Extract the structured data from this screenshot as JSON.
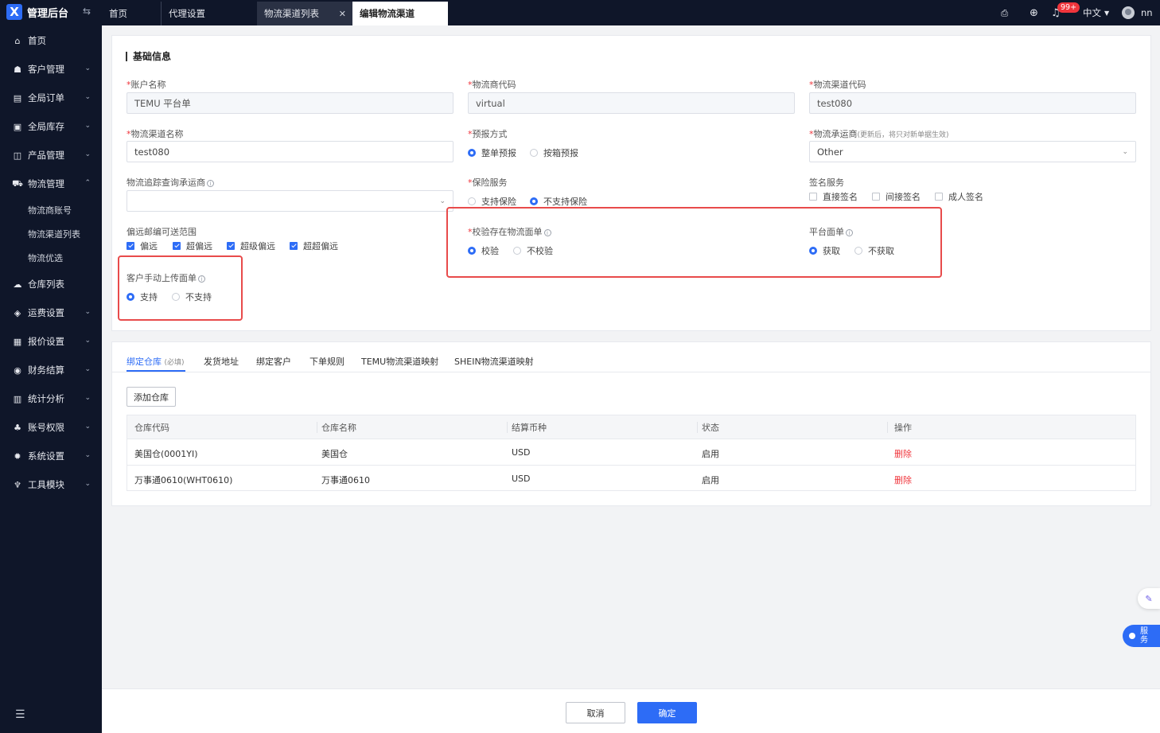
{
  "app": {
    "title": "管理后台"
  },
  "sidebar": {
    "items": [
      {
        "label": "首页",
        "icon": "home-icon",
        "glyph": "⌂"
      },
      {
        "label": "客户管理",
        "icon": "users-icon",
        "glyph": "☗"
      },
      {
        "label": "全局订单",
        "icon": "orders-icon",
        "glyph": "▤"
      },
      {
        "label": "全局库存",
        "icon": "inventory-icon",
        "glyph": "▣"
      },
      {
        "label": "产品管理",
        "icon": "products-icon",
        "glyph": "◫"
      },
      {
        "label": "物流管理",
        "icon": "truck-icon",
        "glyph": "⛟"
      }
    ],
    "logistics_sub": [
      "物流商账号",
      "物流渠道列表",
      "物流优选"
    ],
    "items_after": [
      {
        "label": "仓库列表",
        "icon": "cloud-icon",
        "glyph": "☁"
      },
      {
        "label": "运费设置",
        "icon": "freight-icon",
        "glyph": "◈"
      },
      {
        "label": "报价设置",
        "icon": "quote-icon",
        "glyph": "▦"
      },
      {
        "label": "财务结算",
        "icon": "finance-icon",
        "glyph": "◉"
      },
      {
        "label": "统计分析",
        "icon": "stats-icon",
        "glyph": "▥"
      },
      {
        "label": "账号权限",
        "icon": "permissions-icon",
        "glyph": "♣"
      },
      {
        "label": "系统设置",
        "icon": "settings-icon",
        "glyph": "✹"
      },
      {
        "label": "工具模块",
        "icon": "tools-icon",
        "glyph": "♆"
      }
    ]
  },
  "tabs": [
    {
      "label": "首页"
    },
    {
      "label": "代理设置"
    },
    {
      "label": "物流渠道列表"
    },
    {
      "label": "编辑物流渠道"
    }
  ],
  "topbar": {
    "notification_count": "99+",
    "language": "中文",
    "username": "nn"
  },
  "basic": {
    "section_title": "基础信息",
    "account_name": {
      "label": "账户名称",
      "value": "TEMU 平台单"
    },
    "carrier_code": {
      "label": "物流商代码",
      "value": "virtual"
    },
    "channel_code": {
      "label": "物流渠道代码",
      "value": "test080"
    },
    "channel_name": {
      "label": "物流渠道名称",
      "value": "test080"
    },
    "forecast": {
      "label": "预报方式",
      "options": [
        "整单预报",
        "按箱预报"
      ],
      "selected": 0
    },
    "carrier": {
      "label": "物流承运商",
      "hint": "(更新后，将只对新单据生效)",
      "value": "Other"
    },
    "tracking": {
      "label": "物流追踪查询承运商",
      "value": ""
    },
    "insurance": {
      "label": "保险服务",
      "options": [
        "支持保险",
        "不支持保险"
      ],
      "selected": 1
    },
    "signature": {
      "label": "签名服务",
      "options": [
        "直接签名",
        "间接签名",
        "成人签名"
      ]
    },
    "remote": {
      "label": "偏远邮编可送范围",
      "options": [
        "偏远",
        "超偏远",
        "超级偏远",
        "超超偏远"
      ]
    },
    "verify_label": {
      "label": "校验存在物流面单",
      "options": [
        "校验",
        "不校验"
      ],
      "selected": 0
    },
    "platform_label": {
      "label": "平台面单",
      "options": [
        "获取",
        "不获取"
      ],
      "selected": 0
    },
    "manual_upload": {
      "label": "客户手动上传面单",
      "options": [
        "支持",
        "不支持"
      ],
      "selected": 0
    }
  },
  "bind": {
    "tabs": [
      "绑定仓库",
      "发货地址",
      "绑定客户",
      "下单规则",
      "TEMU物流渠道映射",
      "SHEIN物流渠道映射"
    ],
    "required_hint": "(必填)",
    "add_button": "添加仓库",
    "columns": [
      "仓库代码",
      "仓库名称",
      "结算币种",
      "状态",
      "操作"
    ],
    "rows": [
      [
        "美国仓(0001YI)",
        "美国仓",
        "USD",
        "启用",
        "删除"
      ],
      [
        "万事通0610(WHT0610)",
        "万事通0610",
        "USD",
        "启用",
        "删除"
      ]
    ]
  },
  "footer": {
    "cancel": "取消",
    "confirm": "确定"
  },
  "float": {
    "service": "服务"
  },
  "colors": {
    "primary": "#2d6cf6",
    "sidebar": "#0f1629",
    "danger": "#f0353c",
    "highlight": "#e84b4b"
  }
}
